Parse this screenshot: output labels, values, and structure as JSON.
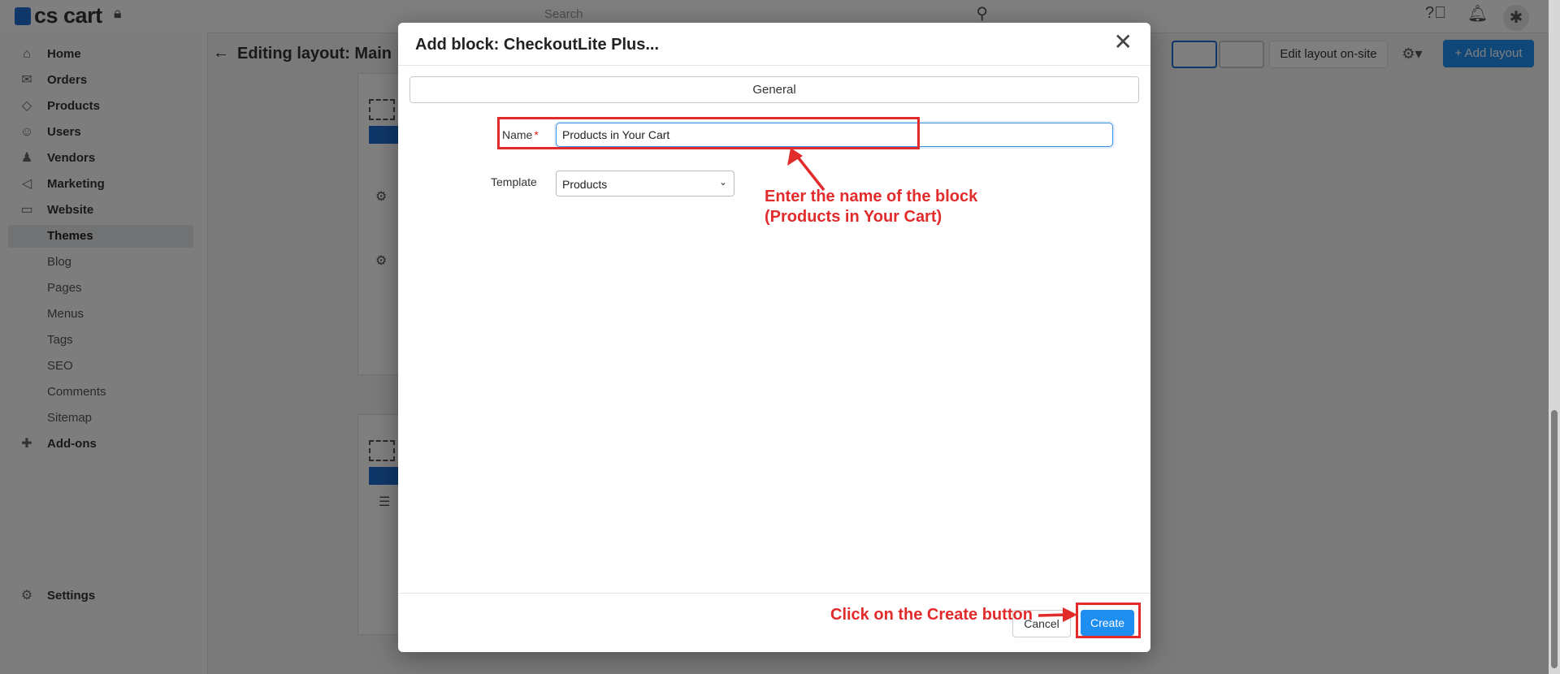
{
  "topbar": {
    "logo": "cs cart",
    "search_placeholder": "Search",
    "icons": [
      "lock-icon",
      "search-icon",
      "help-icon",
      "bell-icon",
      "avatar"
    ]
  },
  "sidebar": {
    "items": [
      {
        "label": "Home",
        "icon": "home-icon"
      },
      {
        "label": "Orders",
        "icon": "orders-icon"
      },
      {
        "label": "Products",
        "icon": "tag-icon"
      },
      {
        "label": "Users",
        "icon": "user-icon"
      },
      {
        "label": "Vendors",
        "icon": "vendors-icon"
      },
      {
        "label": "Marketing",
        "icon": "megaphone-icon"
      },
      {
        "label": "Website",
        "icon": "monitor-icon"
      }
    ],
    "website_sub": [
      "Themes",
      "Blog",
      "Pages",
      "Menus",
      "Tags",
      "SEO",
      "Comments",
      "Sitemap"
    ],
    "addons": "Add-ons",
    "settings": "Settings"
  },
  "page": {
    "title": "Editing layout: Main",
    "edit_layout_onsite": "Edit layout on-site",
    "add_layout": "Add layout"
  },
  "modal": {
    "title": "Add block: CheckoutLite Plus...",
    "tab": "General",
    "name_label": "Name",
    "required_mark": "*",
    "name_value": "Products in Your Cart",
    "template_label": "Template",
    "template_value": "Products",
    "cancel": "Cancel",
    "create": "Create"
  },
  "annotations": {
    "name_hint_line1": "Enter the name of the block",
    "name_hint_line2": "(Products in Your Cart)",
    "create_hint": "Click on the Create button",
    "color": "#e22b2b"
  },
  "colors": {
    "accent": "#1f8ef1",
    "annotation": "#e22b2b"
  }
}
